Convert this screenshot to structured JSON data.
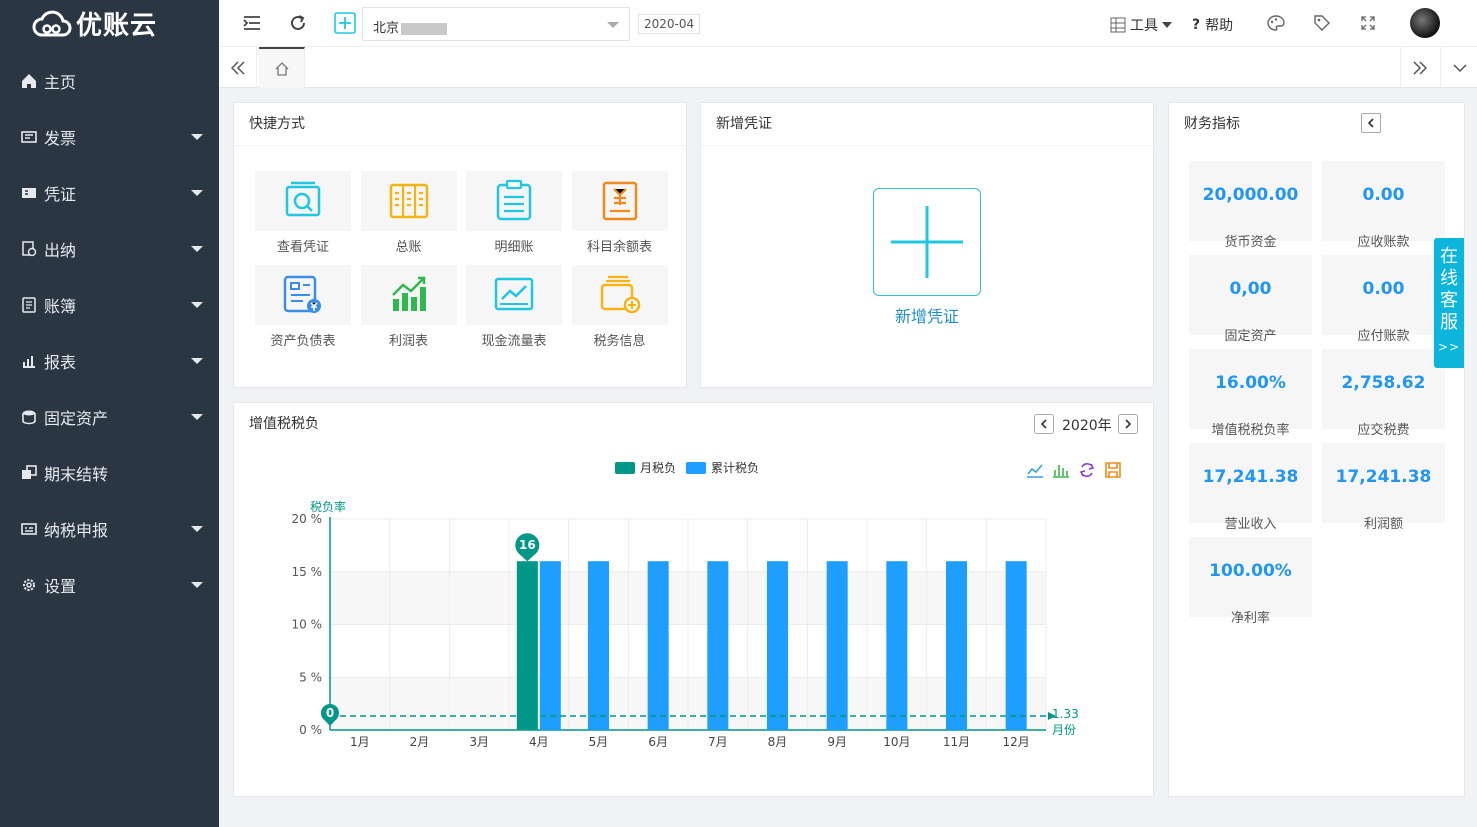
{
  "app": {
    "logo_text": "优账云"
  },
  "sidebar": {
    "items": [
      {
        "label": "主页",
        "icon": "home-icon",
        "caret": false
      },
      {
        "label": "发票",
        "icon": "invoice-icon",
        "caret": true
      },
      {
        "label": "凭证",
        "icon": "voucher-icon",
        "caret": true
      },
      {
        "label": "出纳",
        "icon": "cashier-icon",
        "caret": true
      },
      {
        "label": "账簿",
        "icon": "ledger-icon",
        "caret": true
      },
      {
        "label": "报表",
        "icon": "report-icon",
        "caret": true
      },
      {
        "label": "固定资产",
        "icon": "asset-icon",
        "caret": true
      },
      {
        "label": "期末结转",
        "icon": "transfer-icon",
        "caret": false
      },
      {
        "label": "纳税申报",
        "icon": "tax-declare-icon",
        "caret": true
      },
      {
        "label": "设置",
        "icon": "gear-icon",
        "caret": true
      }
    ]
  },
  "topbar": {
    "company_name": "北京",
    "period": "2020-04",
    "tools_label": "工具",
    "help_label": "帮助"
  },
  "shortcuts": {
    "title": "快捷方式",
    "items": [
      {
        "label": "查看凭证",
        "icon": "view-voucher-icon",
        "color": "#1ec8e0"
      },
      {
        "label": "总账",
        "icon": "general-ledger-icon",
        "color": "#f5b316"
      },
      {
        "label": "明细账",
        "icon": "detail-ledger-icon",
        "color": "#1ec8e0"
      },
      {
        "label": "科目余额表",
        "icon": "balance-sheet-icon",
        "color": "#f08a1c"
      },
      {
        "label": "资产负债表",
        "icon": "asset-liability-icon",
        "color": "#3a8ee6"
      },
      {
        "label": "利润表",
        "icon": "profit-chart-icon",
        "color": "#2fb84f"
      },
      {
        "label": "现金流量表",
        "icon": "cashflow-icon",
        "color": "#1ec8e0"
      },
      {
        "label": "税务信息",
        "icon": "tax-info-icon",
        "color": "#f5b316"
      }
    ]
  },
  "new_voucher": {
    "title": "新增凭证",
    "label": "新增凭证"
  },
  "finance": {
    "title": "财务指标",
    "metrics": [
      {
        "value": "20,000.00",
        "label": "货币资金"
      },
      {
        "value": "0.00",
        "label": "应收账款"
      },
      {
        "value": "0,00",
        "label": "固定资产"
      },
      {
        "value": "0.00",
        "label": "应付账款"
      },
      {
        "value": "16.00%",
        "label": "增值税税负率"
      },
      {
        "value": "2,758.62",
        "label": "应交税费"
      },
      {
        "value": "17,241.38",
        "label": "营业收入"
      },
      {
        "value": "17,241.38",
        "label": "利润额"
      },
      {
        "value": "100.00%",
        "label": "净利率"
      }
    ]
  },
  "service": {
    "label": "在线客服",
    "arrows": ">>"
  },
  "vat_chart": {
    "title": "增值税税负",
    "year": "2020年"
  },
  "colors": {
    "sidebar_bg": "#2b3643",
    "monthly": "#009688",
    "cumulative": "#1e9fff",
    "accent": "#2196f3"
  },
  "chart_data": {
    "type": "bar",
    "title": "增值税税负",
    "ylabel": "税负率",
    "xlabel": "月份",
    "categories": [
      "1月",
      "2月",
      "3月",
      "4月",
      "5月",
      "6月",
      "7月",
      "8月",
      "9月",
      "10月",
      "11月",
      "12月"
    ],
    "y_ticks": [
      "0 %",
      "5 %",
      "10 %",
      "15 %",
      "20 %"
    ],
    "ylim": [
      0,
      20
    ],
    "series": [
      {
        "name": "月税负",
        "values": [
          0,
          0,
          0,
          16,
          0,
          0,
          0,
          0,
          0,
          0,
          0,
          0
        ]
      },
      {
        "name": "累计税负",
        "values": [
          0,
          0,
          0,
          16,
          16,
          16,
          16,
          16,
          16,
          16,
          16,
          16
        ]
      }
    ],
    "markpoints": [
      {
        "month": "1月",
        "value": 0,
        "label": "0"
      },
      {
        "month": "4月",
        "value": 16,
        "label": "16"
      }
    ],
    "markline": {
      "value": 1.33,
      "label": "1.33"
    },
    "legend": "top-center",
    "grid": true
  }
}
